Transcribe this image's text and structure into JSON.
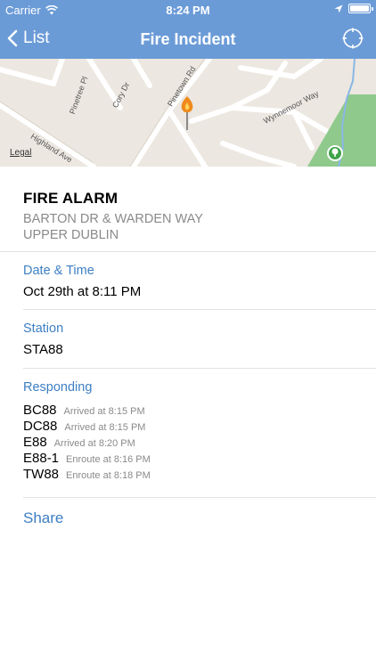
{
  "status_bar": {
    "carrier": "Carrier",
    "time": "8:24 PM"
  },
  "nav": {
    "back_label": "List",
    "title": "Fire Incident"
  },
  "map": {
    "legal": "Legal",
    "streets": [
      "Pinetown Rd",
      "Pinetree Pl",
      "Cory Dr",
      "Wynnemoor Way",
      "Highland Ave"
    ]
  },
  "incident": {
    "type": "FIRE ALARM",
    "address_line1": "BARTON DR & WARDEN WAY",
    "address_line2": "UPPER DUBLIN"
  },
  "date_time": {
    "label": "Date & Time",
    "value": "Oct 29th at 8:11 PM"
  },
  "station": {
    "label": "Station",
    "value": "STA88"
  },
  "responding": {
    "label": "Responding",
    "units": [
      {
        "unit": "BC88",
        "status": "Arrived at 8:15 PM"
      },
      {
        "unit": "DC88",
        "status": "Arrived at 8:15 PM"
      },
      {
        "unit": "E88",
        "status": "Arrived at 8:20 PM"
      },
      {
        "unit": "E88-1",
        "status": "Enroute at 8:16 PM"
      },
      {
        "unit": "TW88",
        "status": "Enroute at 8:18 PM"
      }
    ]
  },
  "share_label": "Share",
  "colors": {
    "nav_bar": "#6b9bd7",
    "accent": "#3d7fc4",
    "secondary_text": "#8a8a8a",
    "park": "#8fc98c"
  },
  "icons": {
    "wifi": "wifi-icon",
    "location_arrow": "location-arrow-icon",
    "battery": "battery-icon",
    "back": "chevron-left-icon",
    "locate": "crosshair-icon",
    "incident_pin": "fire-pin-icon",
    "park_marker": "tree-icon"
  }
}
